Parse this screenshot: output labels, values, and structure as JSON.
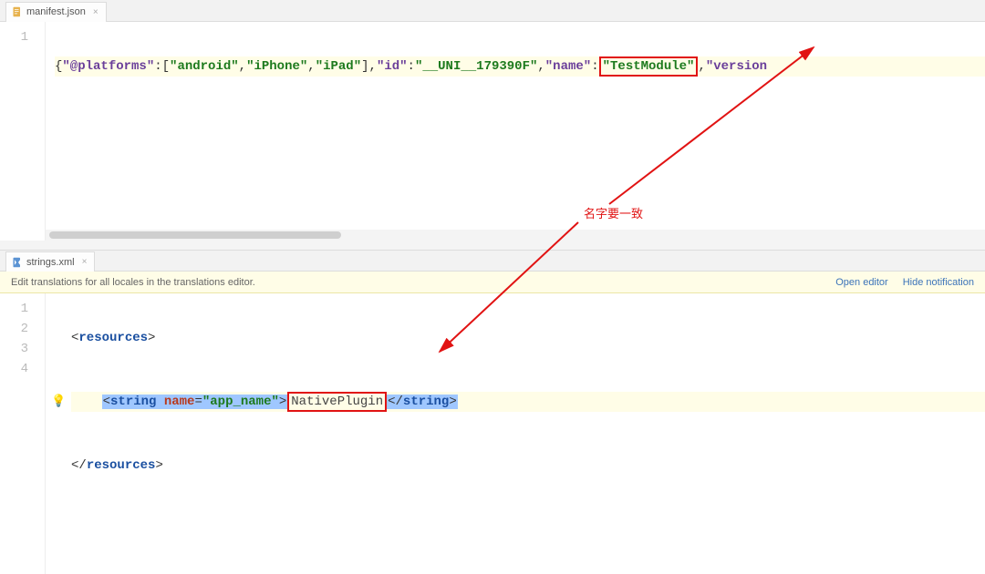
{
  "top": {
    "tab_label": "manifest.json",
    "line_numbers": [
      "1"
    ],
    "code": {
      "brace_open": "{",
      "k_platforms": "\"@platforms\"",
      "colon": ":",
      "bracket_open": "[",
      "v_android": "\"android\"",
      "comma": ",",
      "v_iphone": "\"iPhone\"",
      "v_ipad": "\"iPad\"",
      "bracket_close": "]",
      "k_id": "\"id\"",
      "v_id": "\"__UNI__179390F\"",
      "k_name": "\"name\"",
      "v_name": "\"TestModule\"",
      "k_version": "\"version",
      "trail": ""
    }
  },
  "annotation": {
    "text": "名字要一致"
  },
  "mid": {
    "tab_label": "strings.xml"
  },
  "hint": {
    "message": "Edit translations for all locales in the translations editor.",
    "open_editor": "Open editor",
    "hide_notification": "Hide notification"
  },
  "bottom": {
    "line_numbers": [
      "1",
      "2",
      "3",
      "4"
    ],
    "l1": {
      "lt": "<",
      "tag": "resources",
      "gt": ">"
    },
    "l2": {
      "indent": "    ",
      "lt": "<",
      "tag_open": "string",
      "attr_name": "name",
      "eq": "=",
      "attr_value": "\"app_name\"",
      "gt": ">",
      "text": "NativePlugin",
      "lt2": "</",
      "tag_close": "string",
      "gt2": ">"
    },
    "l3": {
      "lt": "</",
      "tag": "resources",
      "gt": ">"
    }
  }
}
